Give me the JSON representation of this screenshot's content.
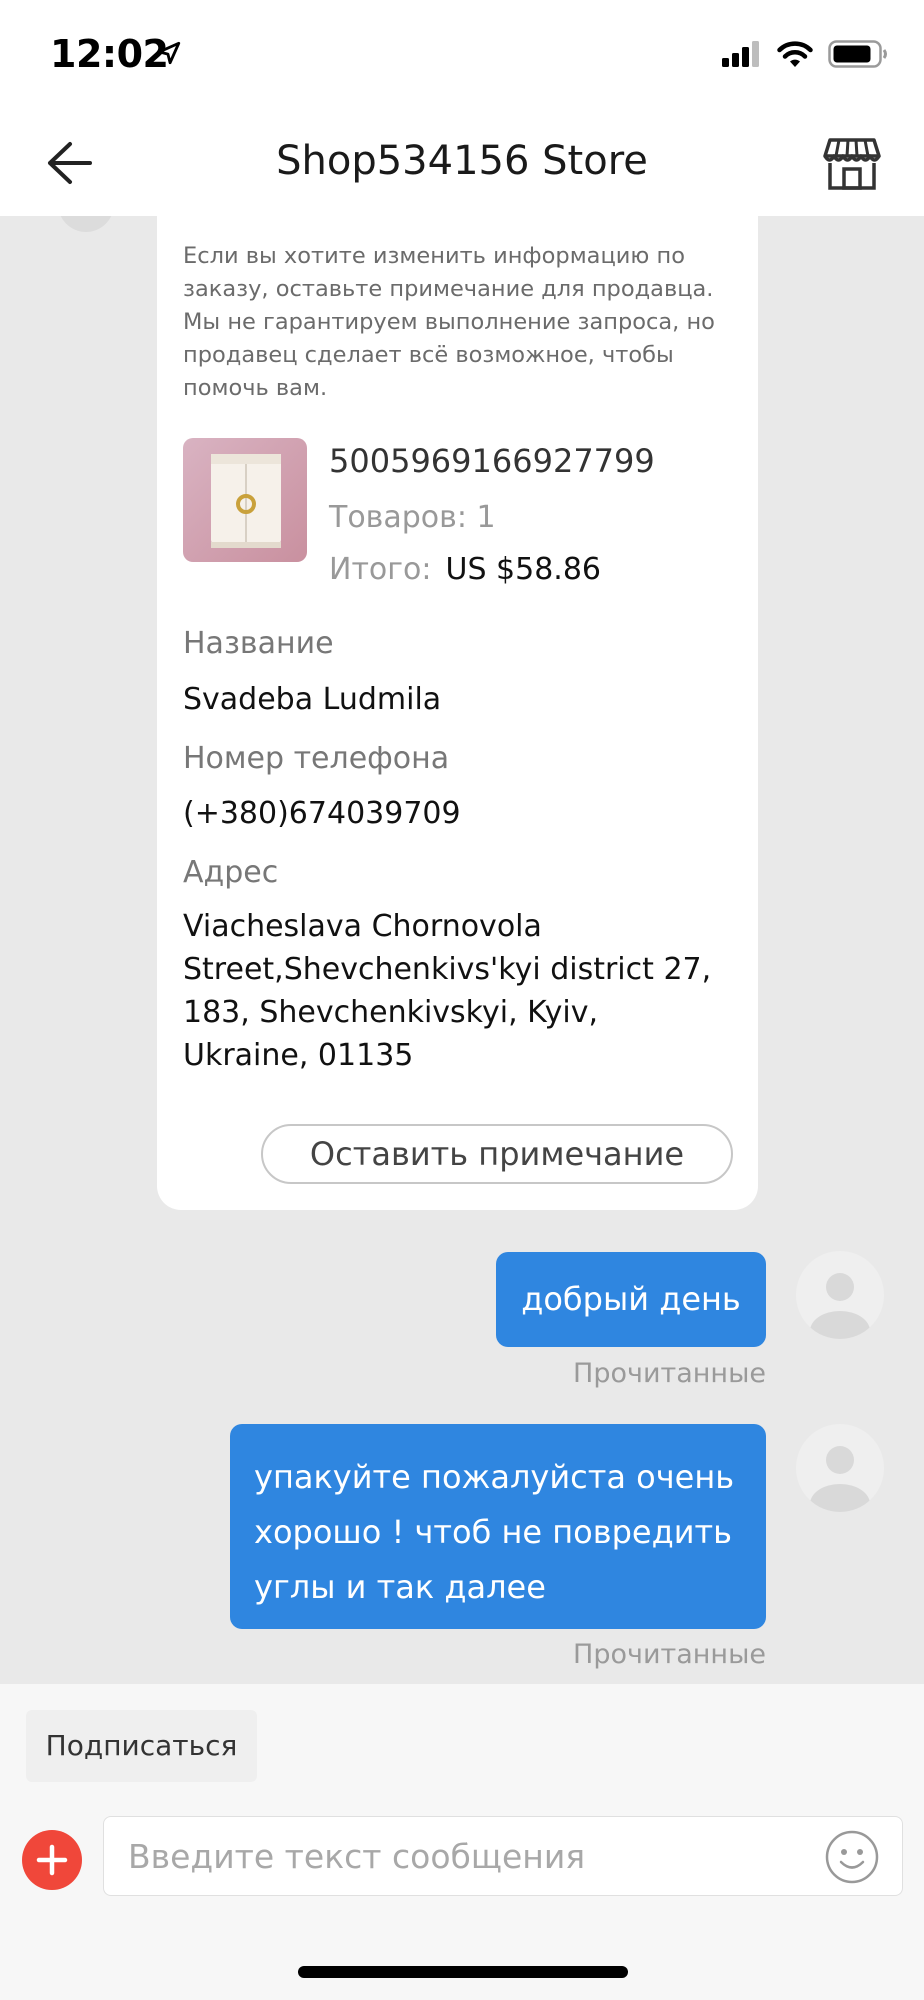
{
  "status_bar": {
    "time": "12:02",
    "location_icon": "location-arrow-icon",
    "signal_icon": "cellular-signal-icon",
    "wifi_icon": "wifi-icon",
    "battery_icon": "battery-icon"
  },
  "header": {
    "title": "Shop534156 Store",
    "back_icon": "back-arrow-icon",
    "store_icon": "storefront-icon"
  },
  "order_card": {
    "notice": "Если вы хотите изменить информацию по заказу, оставьте примечание для продавца. Мы не гарантируем выполнение запроса, но продавец сделает всё возможное, чтобы помочь вам.",
    "order_number": "5005969166927799",
    "goods_count": "Товаров: 1",
    "total_label": "Итого:",
    "total_value": "US $58.86",
    "name_label": "Название",
    "name_value": "Svadeba Ludmila",
    "phone_label": "Номер телефона",
    "phone_value": "(+380)674039709",
    "address_label": "Адрес",
    "address_value": "Viacheslava Chornovola Street,Shevchenkivs'kyi district 27, 183, Shevchenkivskyi, Kyiv, Ukraine, 01135",
    "note_button": "Оставить примечание"
  },
  "messages": [
    {
      "text": "добрый день",
      "status": "Прочитанные"
    },
    {
      "text": "упакуйте пожалуйста очень хорошо ! чтоб не повредить углы и так далее",
      "status": "Прочитанные"
    }
  ],
  "composer": {
    "subscribe_label": "Подписаться",
    "placeholder": "Введите текст сообщения",
    "plus_icon": "plus-icon",
    "emoji_icon": "emoji-smile-icon"
  },
  "colors": {
    "bubble": "#2f86e0",
    "chat_bg": "#e9e9e9",
    "plus_button": "#f0473a"
  }
}
